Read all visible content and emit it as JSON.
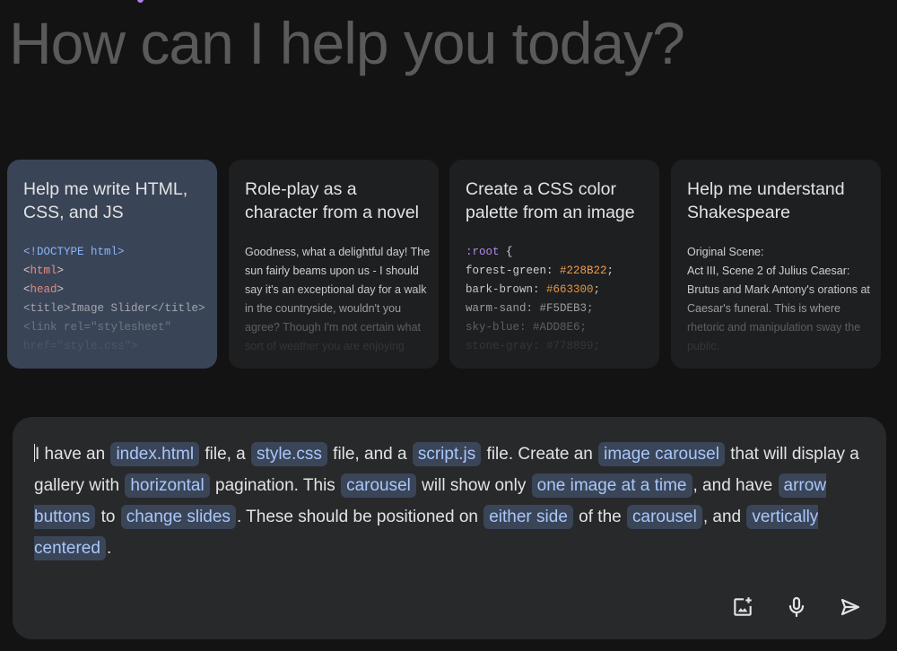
{
  "heading": "How can I help you today?",
  "cards": [
    {
      "title": "Help me write HTML, CSS, and JS",
      "mono": true,
      "lines": [
        [
          {
            "t": "<!DOCTYPE html>",
            "c": "#8ab4f8"
          }
        ],
        [
          {
            "t": "<",
            "c": "#d0d0d0"
          },
          {
            "t": "html",
            "c": "#f28b82"
          },
          {
            "t": ">",
            "c": "#d0d0d0"
          }
        ],
        [
          {
            "t": "<",
            "c": "#d0d0d0"
          },
          {
            "t": "head",
            "c": "#f28b82"
          },
          {
            "t": ">",
            "c": "#d0d0d0"
          }
        ],
        [
          {
            "t": "<title>Image Slider</title>",
            "c": "#d0d0d0"
          }
        ],
        [
          {
            "t": "<link rel=\"stylesheet\"",
            "c": "#d0d0d0"
          }
        ],
        [
          {
            "t": "href=\"style.css\">",
            "c": "#d0d0d0"
          }
        ]
      ]
    },
    {
      "title": "Role-play as a character from a novel",
      "mono": false,
      "lines": [
        [
          {
            "t": "Goodness, what a delightful day! The"
          }
        ],
        [
          {
            "t": "sun fairly beams upon us - I should"
          }
        ],
        [
          {
            "t": "say it's an exceptional day for a walk"
          }
        ],
        [
          {
            "t": "in the countryside, wouldn't you"
          }
        ],
        [
          {
            "t": "agree? Though I'm not certain what"
          }
        ],
        [
          {
            "t": "sort of weather you are enjoying"
          }
        ]
      ]
    },
    {
      "title": "Create a CSS color palette from an image",
      "mono": true,
      "lines": [
        [
          {
            "t": ":root",
            "c": "#b388eb"
          },
          {
            "t": " {",
            "c": "#d0d0d0"
          }
        ],
        [
          {
            "t": "forest-green: ",
            "c": "#d0d0d0"
          },
          {
            "t": "#228B22",
            "c": "#f29b4a"
          },
          {
            "t": ";",
            "c": "#d0d0d0"
          }
        ],
        [
          {
            "t": "bark-brown:  ",
            "c": "#d0d0d0"
          },
          {
            "t": "#663300",
            "c": "#f29b4a"
          },
          {
            "t": ";",
            "c": "#d0d0d0"
          }
        ],
        [
          {
            "t": "warm-sand: #F5DEB3;",
            "c": "#d0d0d0"
          }
        ],
        [
          {
            "t": "sky-blue:  #ADD8E6;",
            "c": "#d0d0d0"
          }
        ],
        [
          {
            "t": "stone-gray: #778899;",
            "c": "#d0d0d0"
          }
        ]
      ]
    },
    {
      "title": "Help me understand Shakespeare",
      "mono": false,
      "lines": [
        [
          {
            "t": "Original Scene:"
          }
        ],
        [
          {
            "t": "Act III, Scene 2 of Julius Caesar:"
          }
        ],
        [
          {
            "t": "Brutus and Mark Antony's orations at"
          }
        ],
        [
          {
            "t": "Caesar's funeral. This is where"
          }
        ],
        [
          {
            "t": "rhetoric and manipulation sway the"
          }
        ],
        [
          {
            "t": "public."
          }
        ]
      ]
    }
  ],
  "prompt": [
    {
      "t": "I have an "
    },
    {
      "t": "index.html",
      "chip": true
    },
    {
      "t": " file, a "
    },
    {
      "t": "style.css",
      "chip": true
    },
    {
      "t": " file, and a "
    },
    {
      "t": "script.js",
      "chip": true
    },
    {
      "t": " file. Create an "
    },
    {
      "t": "image carousel",
      "chip": true
    },
    {
      "t": " that will display a gallery with "
    },
    {
      "t": "horizontal",
      "chip": true
    },
    {
      "t": " pagination. This "
    },
    {
      "t": "carousel",
      "chip": true
    },
    {
      "t": " will show only "
    },
    {
      "t": "one image at a time",
      "chip": true
    },
    {
      "t": ", and have "
    },
    {
      "t": "arrow buttons",
      "chip": true
    },
    {
      "t": " to "
    },
    {
      "t": "change slides",
      "chip": true
    },
    {
      "t": ". These should be positioned on "
    },
    {
      "t": "either side",
      "chip": true
    },
    {
      "t": " of the "
    },
    {
      "t": "carousel",
      "chip": true
    },
    {
      "t": ", and "
    },
    {
      "t": "vertically centered",
      "chip": true
    },
    {
      "t": "."
    }
  ],
  "icons": [
    "add-image-icon",
    "microphone-icon",
    "send-icon"
  ],
  "colors": {
    "chip_bg": "#3b4558",
    "chip_text": "#a8c7fa",
    "active_card": "#3a4457"
  }
}
